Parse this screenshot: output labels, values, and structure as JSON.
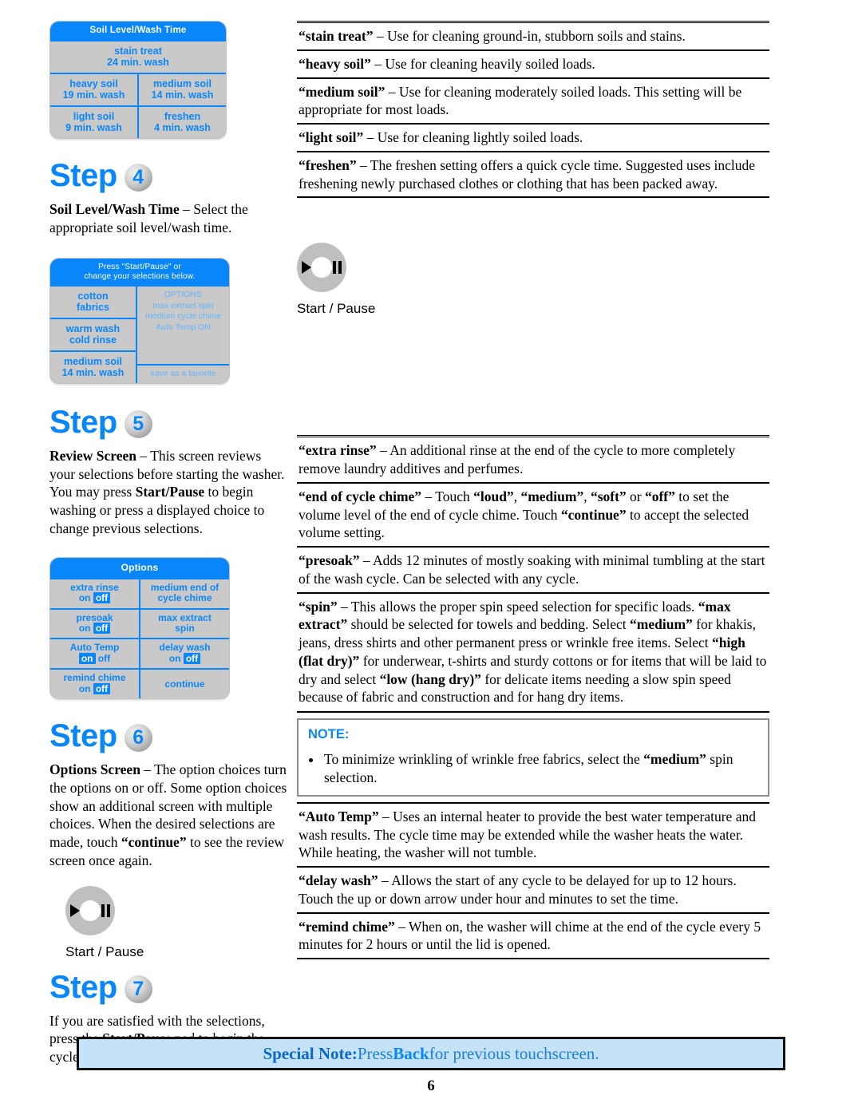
{
  "panels": {
    "soil": {
      "title": "Soil Level/Wash Time",
      "cells": [
        [
          {
            "l1": "stain treat",
            "l2": "24 min. wash"
          }
        ],
        [
          {
            "l1": "heavy soil",
            "l2": "19 min. wash"
          },
          {
            "l1": "medium soil",
            "l2": "14 min. wash"
          }
        ],
        [
          {
            "l1": "light soil",
            "l2": "9 min. wash"
          },
          {
            "l1": "freshen",
            "l2": "4 min. wash"
          }
        ]
      ]
    },
    "review": {
      "title_l1": "Press \"Start/Pause\" or",
      "title_l2": "change your selections below.",
      "left": [
        {
          "l1": "cotton",
          "l2": "fabrics"
        },
        {
          "l1": "warm wash",
          "l2": "cold rinse"
        },
        {
          "l1": "medium soil",
          "l2": "14 min. wash"
        }
      ],
      "options_title": "OPTIONS",
      "options_lines": [
        "max extract spin",
        "medium cycle chime",
        "Auto Temp ON"
      ],
      "favorite": "save as a favorite"
    },
    "options": {
      "title": "Options",
      "cells": [
        {
          "label": "extra rinse",
          "on": "on",
          "off": "off",
          "selected": "off"
        },
        {
          "label_l1": "medium end of",
          "label_l2": "cycle chime"
        },
        {
          "label": "presoak",
          "on": "on",
          "off": "off",
          "selected": "off"
        },
        {
          "label_l1": "max extract",
          "label_l2": "spin"
        },
        {
          "label": "Auto Temp",
          "on": "on",
          "off": "off",
          "selected": "on"
        },
        {
          "label": "delay wash",
          "on": "on",
          "off": "off",
          "selected": "off"
        },
        {
          "label": "remind chime",
          "on": "on",
          "off": "off",
          "selected": "off"
        },
        {
          "label_l1": "continue"
        }
      ]
    }
  },
  "steps": {
    "word": "Step",
    "s4": {
      "num": "4",
      "lead": "Soil Level/Wash Time",
      "rest": " – Select the appropriate soil level/wash time."
    },
    "s5": {
      "num": "5",
      "lead": "Review Screen",
      "mid": " – This screen reviews your selections before starting the washer. You may press ",
      "bold2": "Start/Pause",
      "rest": " to begin washing or press a displayed choice to change previous selections."
    },
    "s6": {
      "num": "6",
      "lead": "Options Screen",
      "mid": " – The option choices turn the options on or off. Some option choices show an additional screen with multiple choices. When the desired selections are made, touch ",
      "bold2": "“continue”",
      "rest": " to see the review screen once again."
    },
    "s7": {
      "num": "7",
      "pre": "If you are satisfied with the selections, press the ",
      "bold": "Start/Pause",
      "post": " pad to begin the cycle."
    }
  },
  "dial": {
    "label": "Start / Pause",
    "play_icon": "play-triangle-icon",
    "pause_icon": "pause-bars-icon"
  },
  "definitions_top": [
    {
      "term": "“stain treat”",
      "text": " – Use for cleaning ground-in, stubborn soils and stains."
    },
    {
      "term": "“heavy soil”",
      "text": " – Use for cleaning heavily soiled loads."
    },
    {
      "term": "“medium soil”",
      "text": " – Use for cleaning moderately soiled loads. This setting will be appropriate for most loads."
    },
    {
      "term": "“light soil”",
      "text": " – Use for cleaning lightly soiled loads."
    },
    {
      "term": "“freshen”",
      "text": " – The freshen setting offers a quick cycle time. Suggested uses include freshening newly purchased clothes or clothing that has been packed away."
    }
  ],
  "definitions_bottom": {
    "extra_rinse": {
      "term": "“extra rinse”",
      "text": " – An additional rinse at the end of the cycle to more completely remove laundry additives and perfumes."
    },
    "chime": {
      "term": "“end of cycle chime”",
      "t1": " – Touch ",
      "b1": "“loud”",
      "t2": ", ",
      "b2": "“medium”",
      "t3": ", ",
      "b3": "“soft”",
      "t4": " or ",
      "b4": "“off”",
      "t5": " to set the volume level of the end of cycle chime. Touch ",
      "b5": "“continue”",
      "t6": " to accept the selected volume setting."
    },
    "presoak": {
      "term": "“presoak”",
      "text": " – Adds 12 minutes of mostly soaking with minimal tumbling at the start of the wash cycle.  Can be selected with any cycle."
    },
    "spin": {
      "term": "“spin”",
      "t1": " – This allows the proper spin speed selection for specific loads.  ",
      "b1": "“max extract”",
      "t2": " should be selected for towels and bedding.  Select ",
      "b2": "“medium”",
      "t3": " for khakis, jeans, dress shirts and other permanent press or wrinkle free items. Select ",
      "b3": "“high (flat dry)”",
      "t4": " for underwear, t-shirts and sturdy cottons or for items that will be laid to dry and select ",
      "b4": "“low (hang dry)”",
      "t5": " for delicate items needing a slow spin speed because of fabric and construction and for hang dry items."
    },
    "note": {
      "title": "NOTE:",
      "t1": "To minimize wrinkling of wrinkle free fabrics, select the ",
      "b1": "“medium”",
      "t2": " spin selection."
    },
    "auto_temp": {
      "term": "“Auto Temp”",
      "text": " – Uses an internal heater to provide the best water temperature and wash results. The cycle time may be extended while the washer heats the water. While heating, the washer will not tumble."
    },
    "delay_wash": {
      "term": "“delay wash”",
      "text": " – Allows the start of any cycle to be delayed for up to 12 hours. Touch the up or down arrow under hour and minutes to set the time."
    },
    "remind_chime": {
      "term": "“remind chime”",
      "text": " – When on, the washer will chime at the end of the cycle every 5 minutes for 2 hours or until the lid is opened."
    }
  },
  "banner": {
    "b1": "Special Note:",
    "t1": " Press ",
    "b2": "Back",
    "t2": " for previous touchscreen."
  },
  "page_number": "6",
  "colors": {
    "lcd_blue": "#0a86fb",
    "lcd_gray": "#c9c9c9",
    "banner_bg": "#c5e2f7",
    "note_blue": "#0a86fb"
  }
}
